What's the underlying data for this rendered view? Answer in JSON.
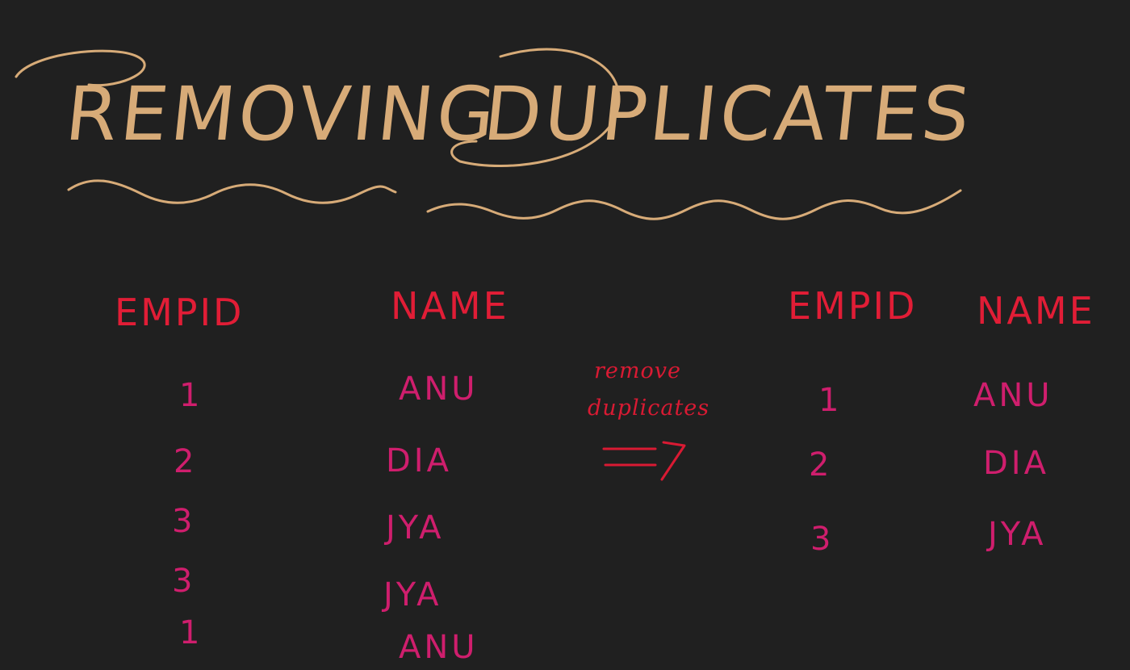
{
  "title": {
    "word1": "REMOVING",
    "word2": "DUPLICATES"
  },
  "colors": {
    "background": "#202020",
    "title": "#d7ab78",
    "header": "#e11d36",
    "cell": "#cf1e6d",
    "note": "#d91a33"
  },
  "left_table": {
    "headers": [
      "EMPID",
      "NAME"
    ],
    "rows": [
      [
        "1",
        "ANU"
      ],
      [
        "2",
        "DIA"
      ],
      [
        "3",
        "JYA"
      ],
      [
        "3",
        "JYA"
      ],
      [
        "1",
        "ANU"
      ]
    ]
  },
  "transform": {
    "line1": "remove",
    "line2": "duplicates",
    "arrow": "=>"
  },
  "right_table": {
    "headers": [
      "EMPID",
      "NAME"
    ],
    "rows": [
      [
        "1",
        "ANU"
      ],
      [
        "2",
        "DIA"
      ],
      [
        "3",
        "JYA"
      ]
    ]
  }
}
